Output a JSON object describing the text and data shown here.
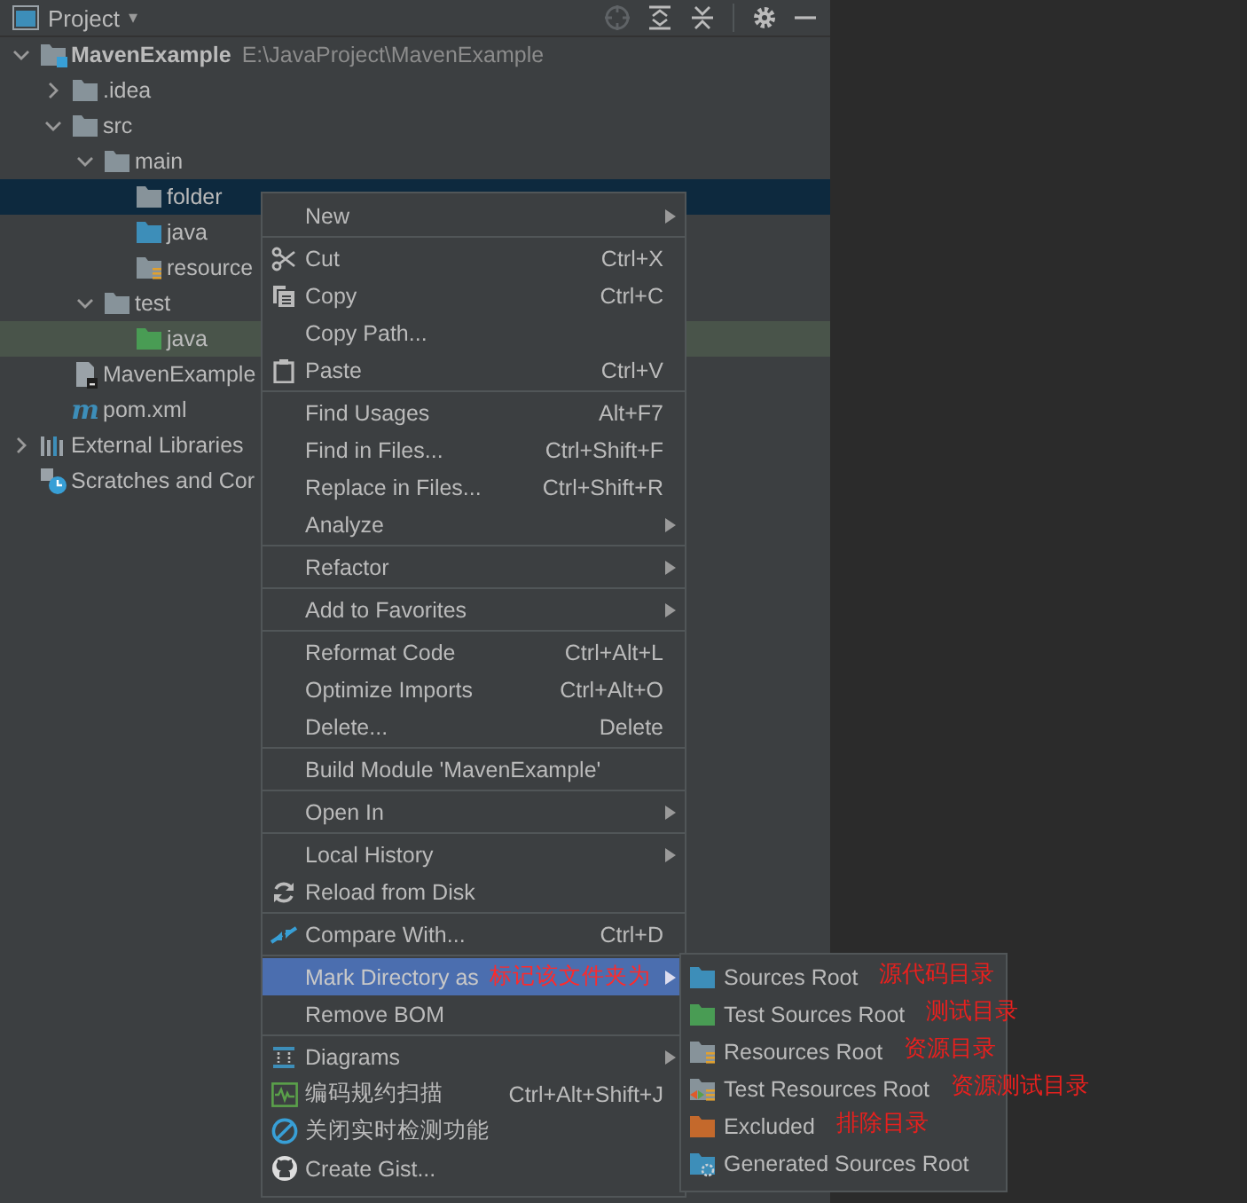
{
  "panel": {
    "title": "Project",
    "caret": "▾"
  },
  "tree": [
    {
      "label": "MavenExample",
      "hint": "E:\\JavaProject\\MavenExample",
      "kind": "module",
      "bold": true,
      "expanded": true,
      "selected": false,
      "tinted": false,
      "children": [
        {
          "label": ".idea",
          "kind": "folder",
          "expanded": false,
          "selected": false,
          "tinted": false
        },
        {
          "label": "src",
          "kind": "folder",
          "expanded": true,
          "selected": false,
          "tinted": false,
          "children": [
            {
              "label": "main",
              "kind": "folder",
              "expanded": true,
              "selected": false,
              "tinted": false,
              "children": [
                {
                  "label": "folder",
                  "kind": "folder",
                  "selected": true,
                  "tinted": false
                },
                {
                  "label": "java",
                  "kind": "source",
                  "selected": false,
                  "tinted": false
                },
                {
                  "label": "resource",
                  "kind": "resource",
                  "selected": false,
                  "tinted": false
                }
              ]
            },
            {
              "label": "test",
              "kind": "folder",
              "expanded": true,
              "selected": false,
              "tinted": false,
              "children": [
                {
                  "label": "java",
                  "kind": "test",
                  "selected": false,
                  "tinted": true
                }
              ]
            }
          ]
        },
        {
          "label": "MavenExample",
          "kind": "iml",
          "selected": false,
          "tinted": false
        },
        {
          "label": "pom.xml",
          "kind": "maven",
          "icon_text": "m",
          "selected": false,
          "tinted": false
        }
      ]
    },
    {
      "label": "External Libraries",
      "kind": "libraries",
      "expanded": false,
      "selected": false,
      "tinted": false
    },
    {
      "label": "Scratches and Cor",
      "kind": "scratches",
      "selected": false,
      "tinted": false
    }
  ],
  "context_menu": {
    "groups": [
      [
        {
          "label": "New",
          "submenu": true,
          "selected": false
        }
      ],
      [
        {
          "label": "Cut",
          "shortcut": "Ctrl+X",
          "kind": "scissors",
          "selected": false
        },
        {
          "label": "Copy",
          "shortcut": "Ctrl+C",
          "kind": "copy",
          "selected": false
        },
        {
          "label": "Copy Path...",
          "selected": false
        },
        {
          "label": "Paste",
          "shortcut": "Ctrl+V",
          "kind": "paste",
          "selected": false
        }
      ],
      [
        {
          "label": "Find Usages",
          "shortcut": "Alt+F7",
          "selected": false
        },
        {
          "label": "Find in Files...",
          "shortcut": "Ctrl+Shift+F",
          "selected": false
        },
        {
          "label": "Replace in Files...",
          "shortcut": "Ctrl+Shift+R",
          "selected": false
        },
        {
          "label": "Analyze",
          "submenu": true,
          "selected": false
        }
      ],
      [
        {
          "label": "Refactor",
          "submenu": true,
          "selected": false
        }
      ],
      [
        {
          "label": "Add to Favorites",
          "submenu": true,
          "selected": false
        }
      ],
      [
        {
          "label": "Reformat Code",
          "shortcut": "Ctrl+Alt+L",
          "selected": false
        },
        {
          "label": "Optimize Imports",
          "shortcut": "Ctrl+Alt+O",
          "selected": false
        },
        {
          "label": "Delete...",
          "shortcut": "Delete",
          "selected": false
        }
      ],
      [
        {
          "label": "Build Module 'MavenExample'",
          "selected": false
        }
      ],
      [
        {
          "label": "Open In",
          "submenu": true,
          "selected": false
        }
      ],
      [
        {
          "label": "Local History",
          "submenu": true,
          "selected": false
        },
        {
          "label": "Reload from Disk",
          "kind": "reload",
          "selected": false
        }
      ],
      [
        {
          "label": "Compare With...",
          "shortcut": "Ctrl+D",
          "kind": "compare",
          "selected": false
        }
      ],
      [
        {
          "label": "Mark Directory as",
          "annotation": "标记该文件夹为",
          "submenu": true,
          "selected": true
        },
        {
          "label": "Remove BOM",
          "selected": false
        }
      ],
      [
        {
          "label": "Diagrams",
          "kind": "diagrams",
          "submenu": true,
          "selected": false
        },
        {
          "label": "编码规约扫描",
          "shortcut": "Ctrl+Alt+Shift+J",
          "kind": "scan",
          "selected": false
        },
        {
          "label": "关闭实时检测功能",
          "kind": "ban",
          "selected": false
        },
        {
          "label": "Create Gist...",
          "kind": "github",
          "selected": false
        }
      ]
    ]
  },
  "submenu": {
    "groups": [
      [
        {
          "label": "Sources Root",
          "annotation": "源代码目录",
          "kind": "source",
          "selected": false
        },
        {
          "label": "Test Sources Root",
          "annotation": "测试目录",
          "kind": "test",
          "selected": false
        },
        {
          "label": "Resources Root",
          "annotation": "资源目录",
          "kind": "resource",
          "selected": false
        },
        {
          "label": "Test Resources Root",
          "annotation": "资源测试目录",
          "kind": "test-resource",
          "selected": false
        },
        {
          "label": "Excluded",
          "annotation": "排除目录",
          "kind": "excluded",
          "selected": false
        },
        {
          "label": "Generated Sources Root",
          "kind": "generated",
          "selected": false
        }
      ]
    ]
  }
}
